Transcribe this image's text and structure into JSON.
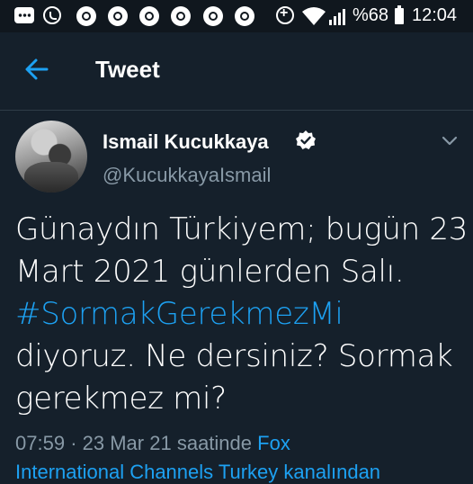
{
  "status_bar": {
    "battery": "%68",
    "time": "12:04",
    "icons": [
      "message-icon",
      "whatsapp-icon",
      "chrome-icon",
      "chrome-icon",
      "chrome-icon",
      "chrome-icon",
      "chrome-icon",
      "chrome-icon",
      "data-saver-icon",
      "wifi-icon",
      "signal-icon",
      "battery-icon"
    ]
  },
  "header": {
    "title": "Tweet",
    "back_icon": "arrow-left-icon"
  },
  "author": {
    "name": "Ismail Kucukkaya",
    "handle": "@KucukkayaIsmail",
    "verified": true
  },
  "tweet": {
    "line1": "Günaydın Türkiyem; bugün 23",
    "line2": "Mart 2021 günlerden Salı.",
    "hashtag": "#SormakGerekmezMi",
    "line4": "diyoruz. Ne dersiniz? Sormak",
    "line5": "gerekmez mi?"
  },
  "meta": {
    "time": "07:59",
    "separator": "·",
    "date": "23 Mar 21",
    "via": "saatinde",
    "source_start": "Fox",
    "source_line2": "International Channels Turkey kanalından"
  },
  "colors": {
    "background": "#15202b",
    "accent": "#1da1f2",
    "muted": "#8899a6"
  }
}
